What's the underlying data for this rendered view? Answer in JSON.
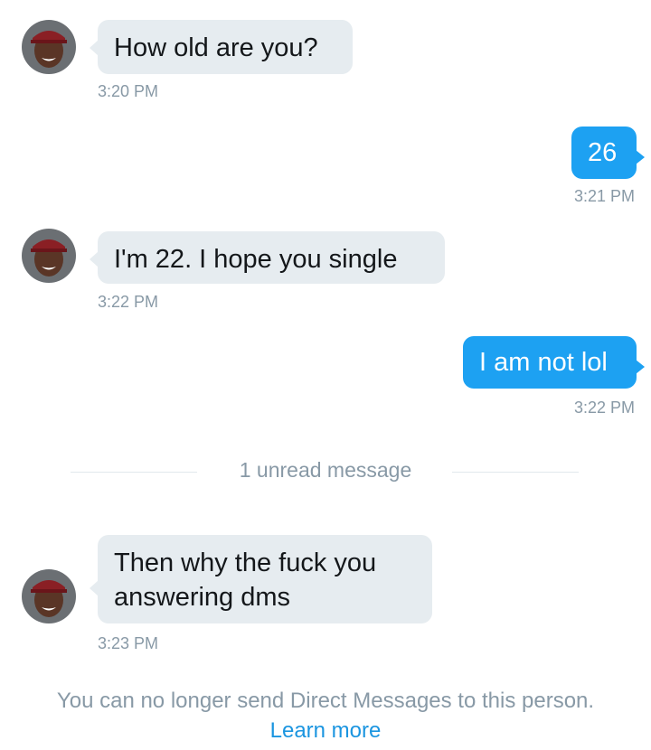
{
  "conversation": {
    "messages": [
      {
        "direction": "incoming",
        "text": "How old are you?",
        "time": "3:20 PM"
      },
      {
        "direction": "outgoing",
        "text": "26",
        "time": "3:21 PM"
      },
      {
        "direction": "incoming",
        "text": "I'm 22. I hope you single",
        "time": "3:22 PM"
      },
      {
        "direction": "outgoing",
        "text": "I am not lol",
        "time": "3:22 PM"
      },
      {
        "direction": "incoming",
        "text_lines": [
          "Then why the fuck you",
          "answering dms"
        ],
        "time": "3:23 PM"
      }
    ],
    "unread_divider": "1 unread message"
  },
  "footer": {
    "notice": "You can no longer send Direct Messages to this person.",
    "learn_more": "Learn more"
  },
  "colors": {
    "incoming_bubble": "#e6ecf0",
    "outgoing_bubble": "#1da1f2",
    "timestamp": "#8899a6",
    "link": "#1b95e0"
  },
  "icons": {
    "avatar": "sender-avatar-photo"
  }
}
